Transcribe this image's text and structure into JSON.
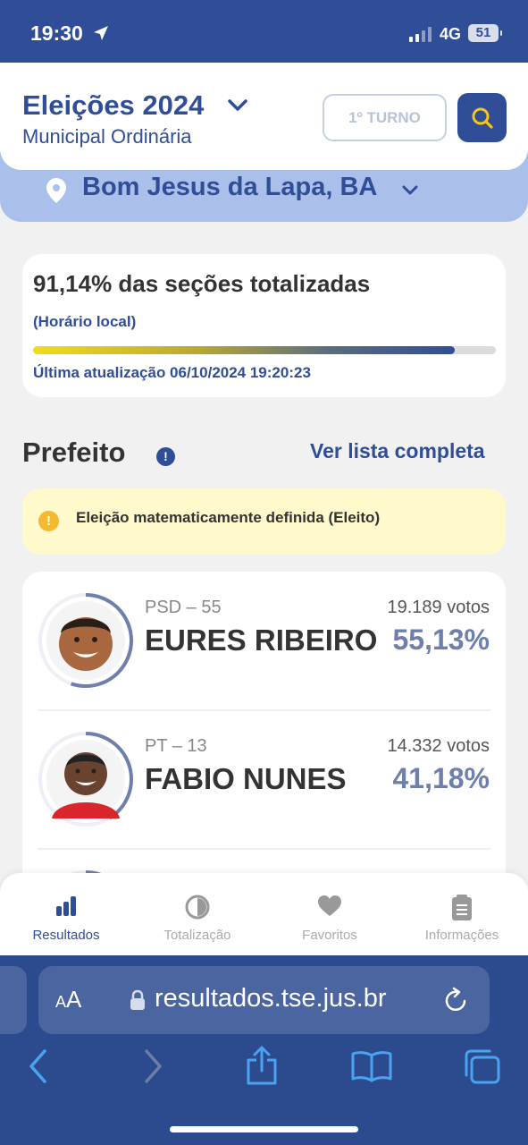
{
  "status_bar": {
    "time": "19:30",
    "network": "4G",
    "battery": "51"
  },
  "header": {
    "title": "Eleições 2024",
    "subtitle": "Municipal Ordinária",
    "turno_label": "1º TURNO"
  },
  "location": {
    "city": "Bom Jesus da Lapa, BA"
  },
  "totalization": {
    "title": "91,14% das seções totalizadas",
    "subtitle": "(Horário local)",
    "progress_percent": 91.14,
    "last_update": "Última atualização 06/10/2024 19:20:23"
  },
  "section": {
    "title": "Prefeito",
    "info_icon": "!",
    "view_all": "Ver lista completa"
  },
  "alert": {
    "icon": "!",
    "text": "Eleição matematicamente definida (Eleito)"
  },
  "candidates": [
    {
      "party": "PSD – 55",
      "name": "EURES RIBEIRO",
      "votes": "19.189 votos",
      "percent": "55,13%",
      "percent_value": 55.13
    },
    {
      "party": "PT – 13",
      "name": "FABIO NUNES",
      "votes": "14.332 votos",
      "percent": "41,18%",
      "percent_value": 41.18
    }
  ],
  "tabs": [
    {
      "label": "Resultados",
      "icon": "bar-chart-icon",
      "active": true
    },
    {
      "label": "Totalização",
      "icon": "pie-chart-icon",
      "active": false
    },
    {
      "label": "Favoritos",
      "icon": "heart-icon",
      "active": false
    },
    {
      "label": "Informações",
      "icon": "clipboard-icon",
      "active": false
    }
  ],
  "browser": {
    "text_size": "AA",
    "url": "resultados.tse.jus.br"
  },
  "colors": {
    "primary": "#2f4e97",
    "percent": "#6f7fab",
    "alert_bg": "#fff9cc",
    "city_band": "#aac0ea"
  }
}
